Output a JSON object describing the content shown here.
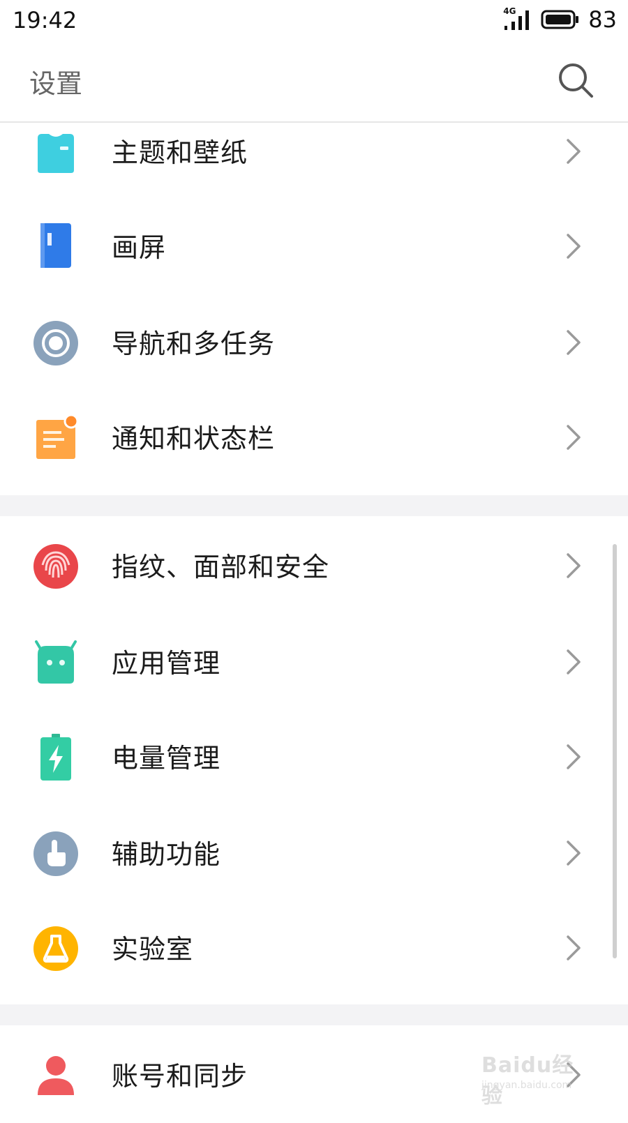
{
  "status_bar": {
    "time": "19:42",
    "network": "4G",
    "battery_level": "83"
  },
  "header": {
    "title": "设置",
    "search_icon": "search-icon"
  },
  "groups": [
    {
      "items": [
        {
          "label": "主题和壁纸",
          "icon": "tshirt-icon",
          "color": "#3ecfe0"
        },
        {
          "label": "画屏",
          "icon": "book-icon",
          "color": "#2f7be8"
        },
        {
          "label": "导航和多任务",
          "icon": "ring-icon",
          "color": "#8aa2bb"
        },
        {
          "label": "通知和状态栏",
          "icon": "notification-icon",
          "color": "#ffa544"
        }
      ]
    },
    {
      "items": [
        {
          "label": "指纹、面部和安全",
          "icon": "fingerprint-icon",
          "color": "#e9464a"
        },
        {
          "label": "应用管理",
          "icon": "android-icon",
          "color": "#33c7a6"
        },
        {
          "label": "电量管理",
          "icon": "battery-bolt-icon",
          "color": "#33cda4"
        },
        {
          "label": "辅助功能",
          "icon": "hand-pointer-icon",
          "color": "#8aa2bb"
        },
        {
          "label": "实验室",
          "icon": "flask-icon",
          "color": "#ffb400"
        }
      ]
    },
    {
      "items": [
        {
          "label": "账号和同步",
          "icon": "person-icon",
          "color": "#ef5a5e"
        }
      ]
    }
  ],
  "watermark": {
    "brand": "Baidu经验",
    "url": "jingyan.baidu.com"
  }
}
